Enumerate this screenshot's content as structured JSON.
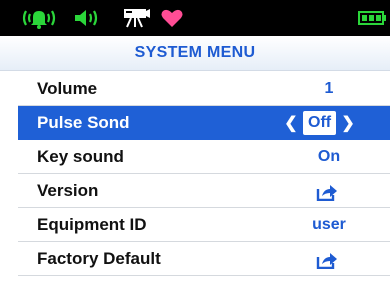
{
  "header": {
    "title": "SYSTEM MENU"
  },
  "status_icons": [
    "alarm-sound-icon",
    "speaker-icon",
    "camera-icon",
    "heart-icon",
    "battery-icon"
  ],
  "menu": {
    "items": [
      {
        "label": "Volume",
        "value": "1"
      },
      {
        "label": "Pulse Sond",
        "value": "Off",
        "selected": true
      },
      {
        "label": "Key sound",
        "value": "On"
      },
      {
        "label": "Version",
        "value_icon": "share-arrow-icon"
      },
      {
        "label": "Equipment ID",
        "value": "user"
      },
      {
        "label": "Factory Default",
        "value_icon": "share-arrow-icon"
      }
    ]
  },
  "colors": {
    "accent": "#1f60d6",
    "status_green": "#2bd63a",
    "heart": "#ff4d95",
    "status_bar": "#000000"
  }
}
